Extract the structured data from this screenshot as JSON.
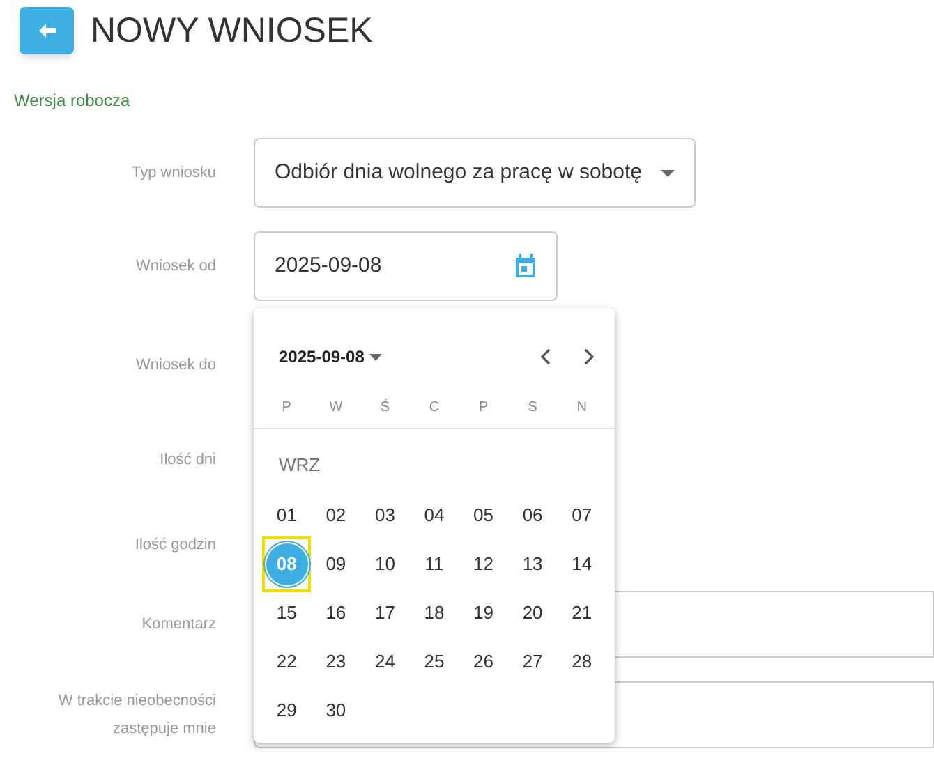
{
  "header": {
    "title": "NOWY WNIOSEK"
  },
  "status": "Wersja robocza",
  "form": [
    {
      "label": "Typ wniosku",
      "kind": "select",
      "value": "Odbiór dnia wolnego za pracę w sobotę"
    },
    {
      "label": "Wniosek od",
      "kind": "date",
      "value": "2025-09-08"
    },
    {
      "label": "Wniosek do",
      "kind": "hidden"
    },
    {
      "label": "Ilość dni",
      "kind": "hidden"
    },
    {
      "label": "Ilość godzin",
      "kind": "hidden"
    },
    {
      "label": "Komentarz",
      "kind": "textarea"
    },
    {
      "label": "W trakcie nieobecności zastępuje mnie",
      "kind": "box"
    }
  ],
  "calendar": {
    "heading": "2025-09-08",
    "month": "WRZ",
    "weekdays": [
      "P",
      "W",
      "Ś",
      "C",
      "P",
      "S",
      "N"
    ],
    "days": [
      {
        "label": "01",
        "selected": false,
        "focused": false
      },
      {
        "label": "02",
        "selected": false,
        "focused": false
      },
      {
        "label": "03",
        "selected": false,
        "focused": false
      },
      {
        "label": "04",
        "selected": false,
        "focused": false
      },
      {
        "label": "05",
        "selected": false,
        "focused": false
      },
      {
        "label": "06",
        "selected": false,
        "focused": false
      },
      {
        "label": "07",
        "selected": false,
        "focused": false
      },
      {
        "label": "08",
        "selected": true,
        "focused": true
      },
      {
        "label": "09",
        "selected": false,
        "focused": false
      },
      {
        "label": "10",
        "selected": false,
        "focused": false
      },
      {
        "label": "11",
        "selected": false,
        "focused": false
      },
      {
        "label": "12",
        "selected": false,
        "focused": false
      },
      {
        "label": "13",
        "selected": false,
        "focused": false
      },
      {
        "label": "14",
        "selected": false,
        "focused": false
      },
      {
        "label": "15",
        "selected": false,
        "focused": false
      },
      {
        "label": "16",
        "selected": false,
        "focused": false
      },
      {
        "label": "17",
        "selected": false,
        "focused": false
      },
      {
        "label": "18",
        "selected": false,
        "focused": false
      },
      {
        "label": "19",
        "selected": false,
        "focused": false
      },
      {
        "label": "20",
        "selected": false,
        "focused": false
      },
      {
        "label": "21",
        "selected": false,
        "focused": false
      },
      {
        "label": "22",
        "selected": false,
        "focused": false
      },
      {
        "label": "23",
        "selected": false,
        "focused": false
      },
      {
        "label": "24",
        "selected": false,
        "focused": false
      },
      {
        "label": "25",
        "selected": false,
        "focused": false
      },
      {
        "label": "26",
        "selected": false,
        "focused": false
      },
      {
        "label": "27",
        "selected": false,
        "focused": false
      },
      {
        "label": "28",
        "selected": false,
        "focused": false
      },
      {
        "label": "29",
        "selected": false,
        "focused": false
      },
      {
        "label": "30",
        "selected": false,
        "focused": false
      }
    ]
  }
}
